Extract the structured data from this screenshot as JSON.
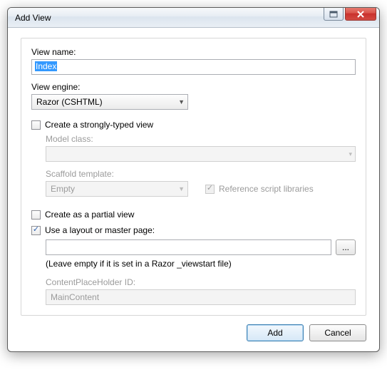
{
  "window": {
    "title": "Add View"
  },
  "form": {
    "viewName": {
      "label": "View name:",
      "value": "Index"
    },
    "viewEngine": {
      "label": "View engine:",
      "value": "Razor (CSHTML)"
    },
    "stronglyTyped": {
      "label": "Create a strongly-typed view",
      "checked": false
    },
    "modelClass": {
      "label": "Model class:",
      "value": ""
    },
    "scaffold": {
      "label": "Scaffold template:",
      "value": "Empty"
    },
    "refScripts": {
      "label": "Reference script libraries",
      "checked": true
    },
    "partial": {
      "label": "Create as a partial view",
      "checked": false
    },
    "useLayout": {
      "label": "Use a layout or master page:",
      "checked": true
    },
    "layoutPath": {
      "value": ""
    },
    "layoutHint": "(Leave empty if it is set in a Razor _viewstart file)",
    "cph": {
      "label": "ContentPlaceHolder ID:",
      "value": "MainContent"
    },
    "browse": "..."
  },
  "buttons": {
    "add": "Add",
    "cancel": "Cancel"
  }
}
